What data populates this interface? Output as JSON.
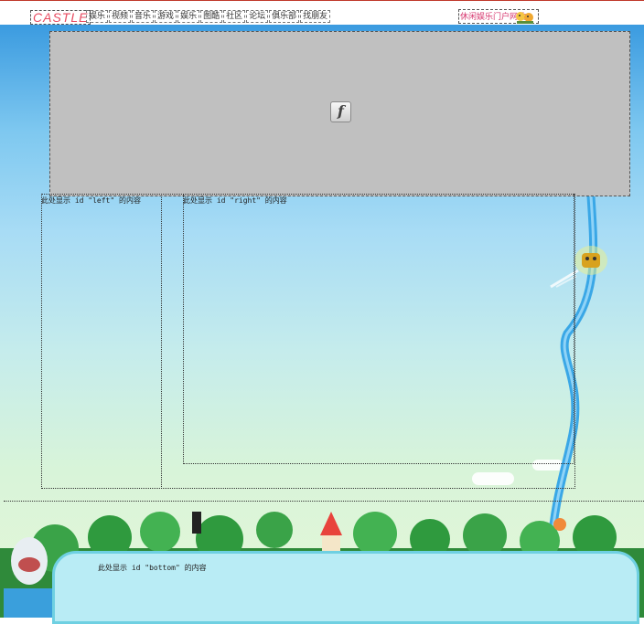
{
  "header": {
    "logo": "CASTLE",
    "nav_items": [
      "娱乐",
      "视频",
      "音乐",
      "游戏",
      "娱乐",
      "图酷",
      "社区",
      "论坛",
      "俱乐部",
      "找朋友"
    ],
    "portal_label": "休闲娱乐门户网站"
  },
  "flash": {
    "icon_glyph": "f"
  },
  "regions": {
    "left_label": "此处显示 id \"left\" 的内容",
    "right_label": "此处显示 id \"right\" 的内容",
    "bottom_label": "此处显示 id \"bottom\" 的内容"
  },
  "colors": {
    "logo": "#e84a5f",
    "portal_text": "#d6336c",
    "flash_bg": "#c0c0c0",
    "ribbon": "#3aa7e6",
    "bottom_bg": "#b9ecf5"
  }
}
